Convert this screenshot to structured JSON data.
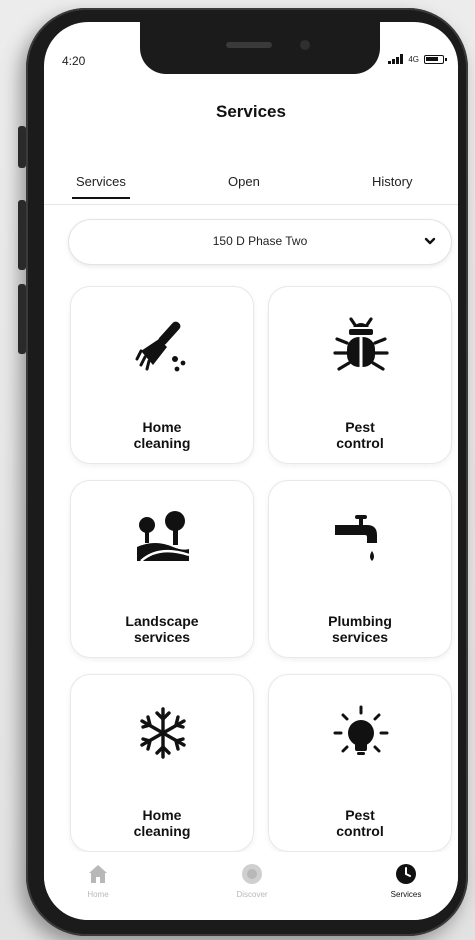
{
  "status_bar": {
    "time": "4:20",
    "network": "4G"
  },
  "header": {
    "title": "Services"
  },
  "tabs": [
    {
      "label": "Services",
      "active": true
    },
    {
      "label": "Open",
      "active": false
    },
    {
      "label": "History",
      "active": false
    }
  ],
  "location_select": {
    "value": "150 D Phase Two"
  },
  "service_cards": [
    {
      "label_line1": "Home",
      "label_line2": "cleaning",
      "icon": "broom-icon"
    },
    {
      "label_line1": "Pest",
      "label_line2": "control",
      "icon": "bug-icon"
    },
    {
      "label_line1": "Landscape",
      "label_line2": "services",
      "icon": "trees-icon"
    },
    {
      "label_line1": "Plumbing",
      "label_line2": "services",
      "icon": "faucet-icon"
    },
    {
      "label_line1": "Home",
      "label_line2": "cleaning",
      "icon": "snowflake-icon"
    },
    {
      "label_line1": "Pest",
      "label_line2": "control",
      "icon": "lightbulb-icon"
    }
  ],
  "bottom_nav": {
    "items": [
      {
        "label": "Home",
        "icon": "home-icon",
        "active": false
      },
      {
        "label": "Discover",
        "icon": "discover-icon",
        "active": false
      },
      {
        "label": "Services",
        "icon": "clock-icon",
        "active": true
      }
    ]
  },
  "colors": {
    "active": "#111111",
    "inactive": "#b8b8b8",
    "card_border": "#e8e8e8"
  }
}
